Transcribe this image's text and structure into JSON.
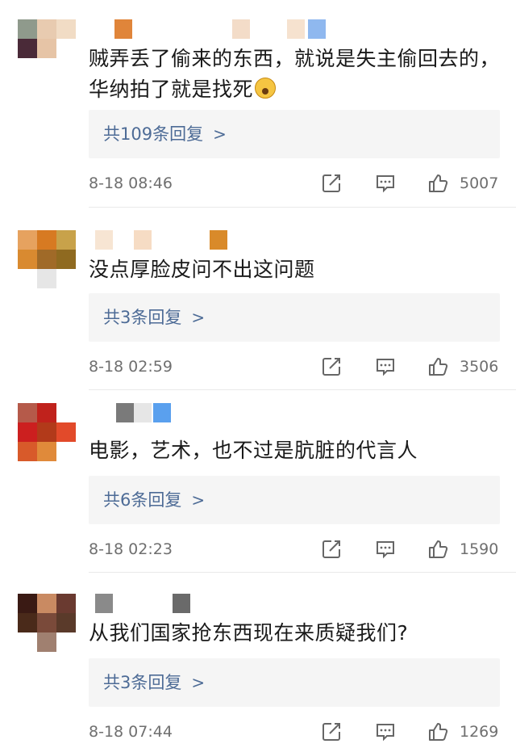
{
  "comments": [
    {
      "text": "贼弄丢了偷来的东西，就说是失主偷回去的，华纳拍了就是找死",
      "replies_label": "共109条回复",
      "time": "8-18 08:46",
      "likes": "5007",
      "avatar_colors": [
        "#8f9a8c",
        "#e8cbb0",
        "#f1dcc5",
        "#4a2a38",
        "#e6c4a6",
        "#ffffff",
        "#ffffff",
        "#ffffff",
        "#ffffff"
      ],
      "name_colors": [
        "#e0853a",
        "#f3dcc8",
        "#f6e2cf",
        "#8fb8ef"
      ]
    },
    {
      "text": "没点厚脸皮问不出这问题",
      "replies_label": "共3条回复",
      "time": "8-18 02:59",
      "likes": "3506",
      "avatar_colors": [
        "#e6a25f",
        "#d77a22",
        "#c8a24a",
        "#d98a30",
        "#a06a28",
        "#8f6a20",
        "#ffffff",
        "#e6e6e6",
        "#ffffff"
      ],
      "name_colors": [
        "#f7e5d3",
        "#f6dcc4",
        "#d98a2a"
      ]
    },
    {
      "text": "电影，艺术，也不过是肮脏的代言人",
      "replies_label": "共6条回复",
      "time": "8-18 02:23",
      "likes": "1590",
      "avatar_colors": [
        "#b55a4a",
        "#c0221c",
        "#ffffff",
        "#cc1f1f",
        "#b23a1a",
        "#e24a2a",
        "#d85a2a",
        "#e08a3a",
        "#ffffff"
      ],
      "name_colors": [
        "#7a7a7a",
        "#e6e6e6",
        "#5aa0ee"
      ]
    },
    {
      "text": "从我们国家抢东西现在来质疑我们?",
      "replies_label": "共3条回复",
      "time": "8-18 07:44",
      "likes": "1269",
      "avatar_colors": [
        "#3a1a14",
        "#c98a62",
        "#6a3a30",
        "#4a2a1a",
        "#7a4a3a",
        "#5a3a2a",
        "#ffffff",
        "#a08070",
        "#ffffff"
      ],
      "name_colors": [
        "#8a8a8a",
        "#ffffff",
        "#6a6a6a"
      ]
    }
  ],
  "icons": {
    "share": "share-icon",
    "comment": "comment-icon",
    "like": "like-icon",
    "chevron": "chevron-right-icon"
  }
}
